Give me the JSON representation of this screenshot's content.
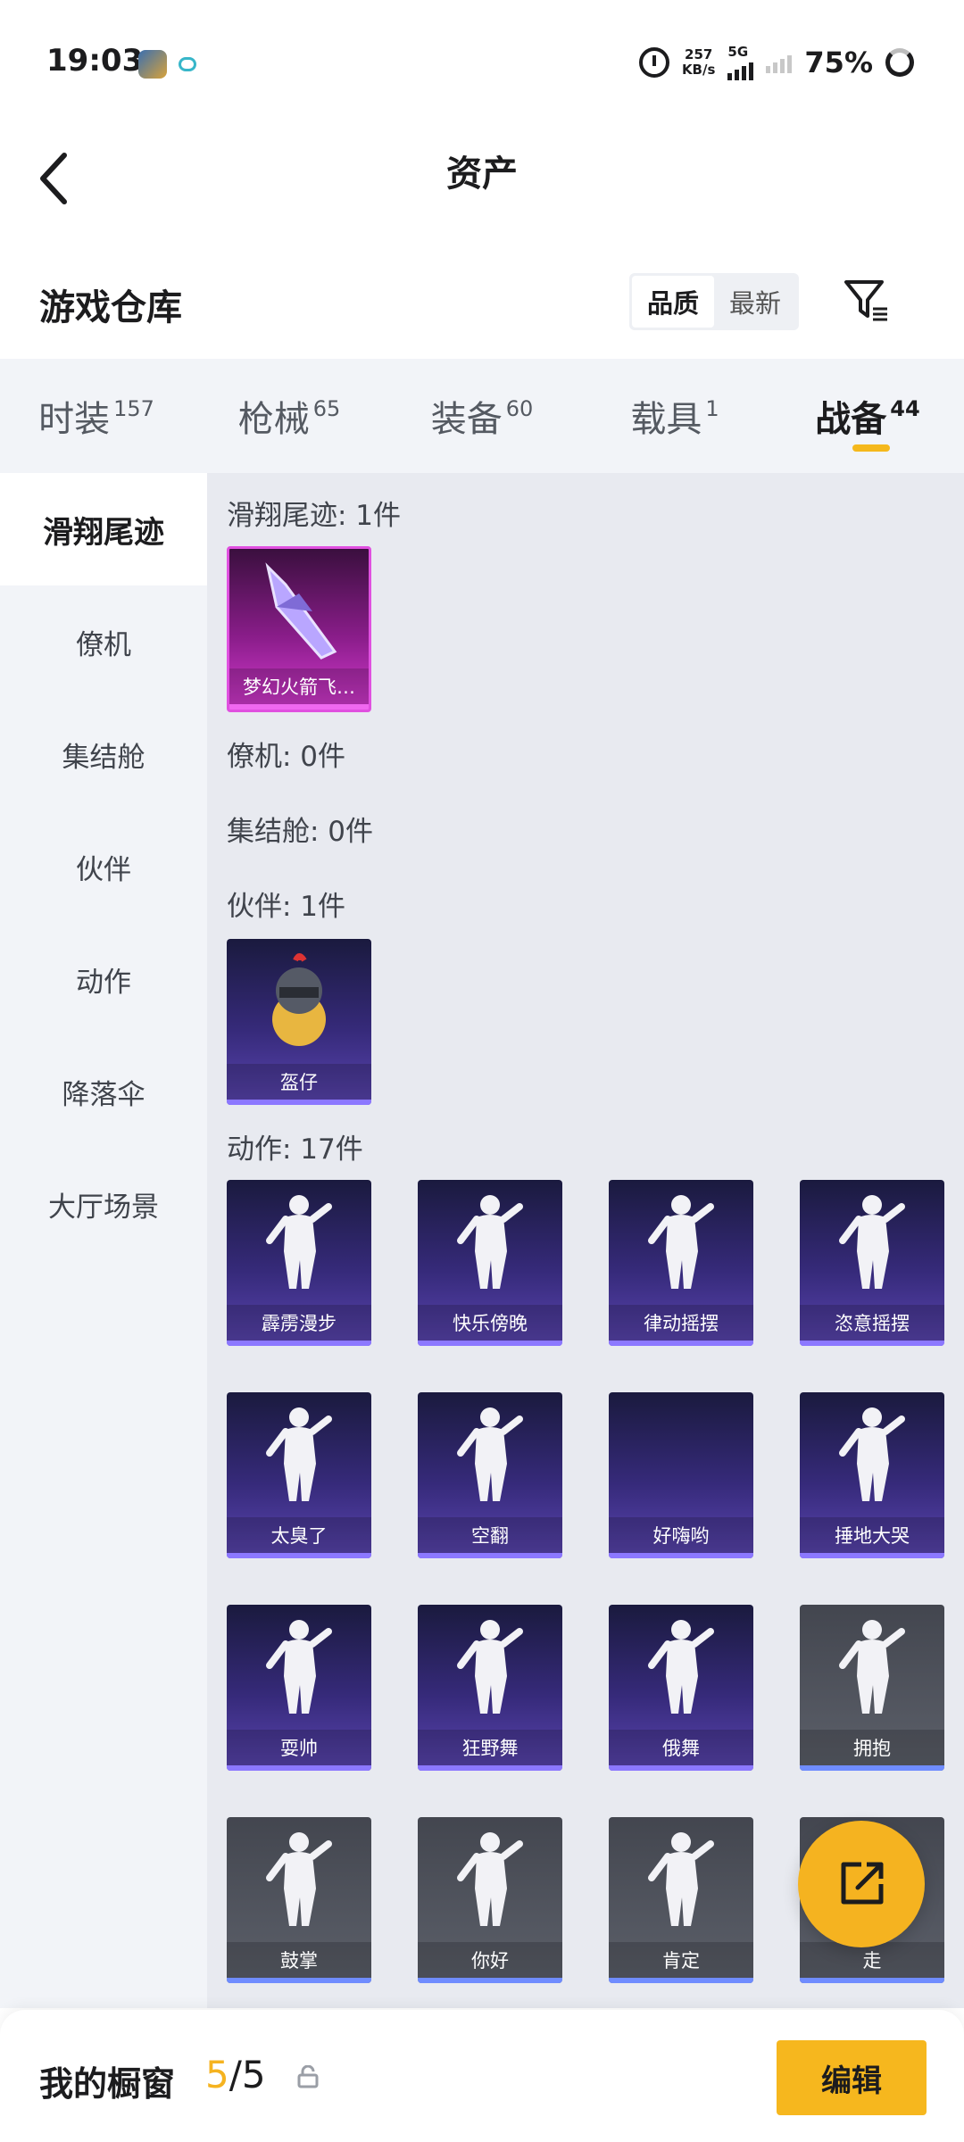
{
  "status_bar": {
    "time": "19:03",
    "speed_value": "257",
    "speed_unit": "KB/s",
    "network": "5G",
    "battery": "75%"
  },
  "nav": {
    "title": "资产"
  },
  "warehouse": {
    "title": "游戏仓库",
    "sort_options": [
      "品质",
      "最新"
    ],
    "active_sort": "品质"
  },
  "tabs": [
    {
      "label": "时装",
      "count": "157"
    },
    {
      "label": "枪械",
      "count": "65"
    },
    {
      "label": "装备",
      "count": "60"
    },
    {
      "label": "载具",
      "count": "1"
    },
    {
      "label": "战备",
      "count": "44",
      "active": true
    }
  ],
  "sidebar": {
    "items": [
      "滑翔尾迹",
      "僚机",
      "集结舱",
      "伙伴",
      "动作",
      "降落伞",
      "大厅场景"
    ],
    "active": "滑翔尾迹"
  },
  "sections": {
    "trail": {
      "title": "滑翔尾迹: 1件",
      "items": [
        "梦幻火箭飞…"
      ]
    },
    "wingman": {
      "title": "僚机: 0件"
    },
    "pod": {
      "title": "集结舱: 0件"
    },
    "partner": {
      "title": "伙伴: 1件",
      "items": [
        "盔仔"
      ]
    },
    "emote": {
      "title": "动作: 17件",
      "items": [
        "霹雳漫步",
        "快乐傍晚",
        "律动摇摆",
        "恣意摇摆",
        "太臭了",
        "空翻",
        "好嗨哟",
        "捶地大哭",
        "耍帅",
        "狂野舞",
        "俄舞",
        "拥抱",
        "鼓掌",
        "你好",
        "肯定",
        "走"
      ]
    }
  },
  "showcase": {
    "label": "我的橱窗",
    "current": "5",
    "total": "/5",
    "edit_label": "编辑"
  },
  "colors": {
    "accent": "#f5b320",
    "purple_card": "#362a7a",
    "pink_card": "#8a1d8a",
    "gray_card": "#5c606a"
  }
}
